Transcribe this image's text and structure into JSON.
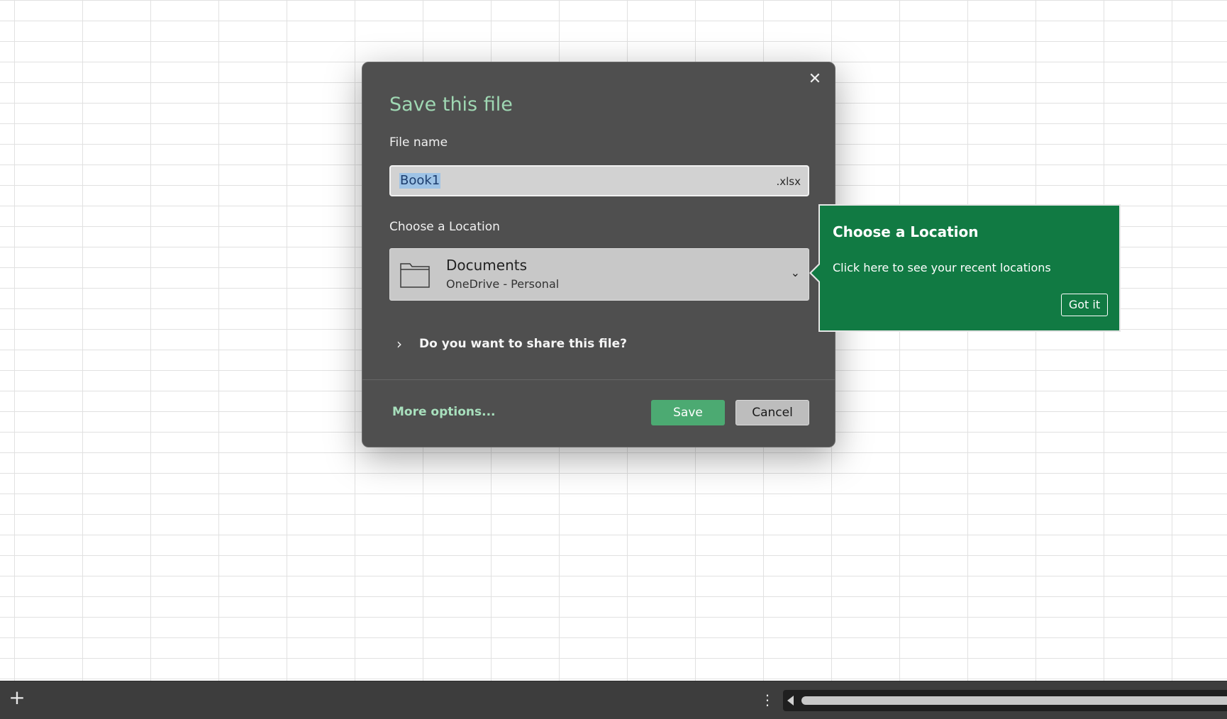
{
  "dialog": {
    "title": "Save this file",
    "close_icon": "close-icon",
    "file_name_label": "File name",
    "file_name_value": "Book1",
    "file_extension": ".xlsx",
    "location_label": "Choose a Location",
    "location": {
      "name": "Documents",
      "sub": "OneDrive - Personal",
      "icon": "folder-icon"
    },
    "share_prompt": "Do you want to share this file?",
    "more_options": "More options...",
    "save_label": "Save",
    "cancel_label": "Cancel"
  },
  "callout": {
    "title": "Choose a Location",
    "text": "Click here to see your recent locations",
    "button": "Got it"
  },
  "sheetbar": {
    "add_icon": "plus-icon",
    "more_icon": "more-vertical-icon"
  },
  "colors": {
    "accent_title": "#9fd8b3",
    "save_button": "#4caa72",
    "callout_bg": "#117a43",
    "dialog_bg": "#4f4f4f"
  }
}
